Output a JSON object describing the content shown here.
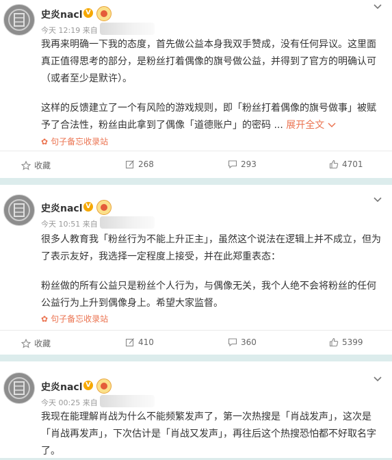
{
  "posts": [
    {
      "username": "史炎nacl",
      "verified_badge": "V",
      "meta": "今天 12:19 来自 i",
      "paragraphs": [
        "我再来明确一下我的态度，首先做公益本身我双手赞成，没有任何异议。这里面真正值得思考的部分，是粉丝打着偶像的旗号做公益，并得到了官方的明确认可（或者至少是默许）。",
        "这样的反馈建立了一个有风险的游戏规则，即「粉丝打着偶像的旗号做事」被赋予了合法性，粉丝由此拿到了偶像「道德账户」的密码 ..."
      ],
      "expand_label": "展开全文",
      "source_label": "句子备忘收录站",
      "actions": {
        "favorite": "收藏",
        "repost": "268",
        "comment": "293",
        "like": "4701"
      }
    },
    {
      "username": "史炎nacl",
      "verified_badge": "V",
      "meta": "今天 10:51 来自",
      "paragraphs": [
        "很多人教育我「粉丝行为不能上升正主」，虽然这个说法在逻辑上并不成立，但为了表示友好，我选择一定程度上接受，并在此郑重表态：",
        "粉丝做的所有公益只是粉丝个人行为，与偶像无关，我个人绝不会将粉丝的任何公益行为上升到偶像身上。希望大家监督。"
      ],
      "source_label": "句子备忘收录站",
      "actions": {
        "favorite": "收藏",
        "repost": "410",
        "comment": "360",
        "like": "5399"
      }
    },
    {
      "username": "史炎nacl",
      "verified_badge": "V",
      "meta": "今天 00:25 来自",
      "paragraphs": [
        "我现在能理解肖战为什么不能频繁发声了，第一次热搜是「肖战发声」，这次是「肖战再发声」，下次估计是「肖战又发声」，再往后这个热搜恐怕都不好取名字了。"
      ]
    }
  ],
  "colors": {
    "page_bg": "#dcecec",
    "accent": "#eb7350",
    "badge": "#f6a800"
  }
}
